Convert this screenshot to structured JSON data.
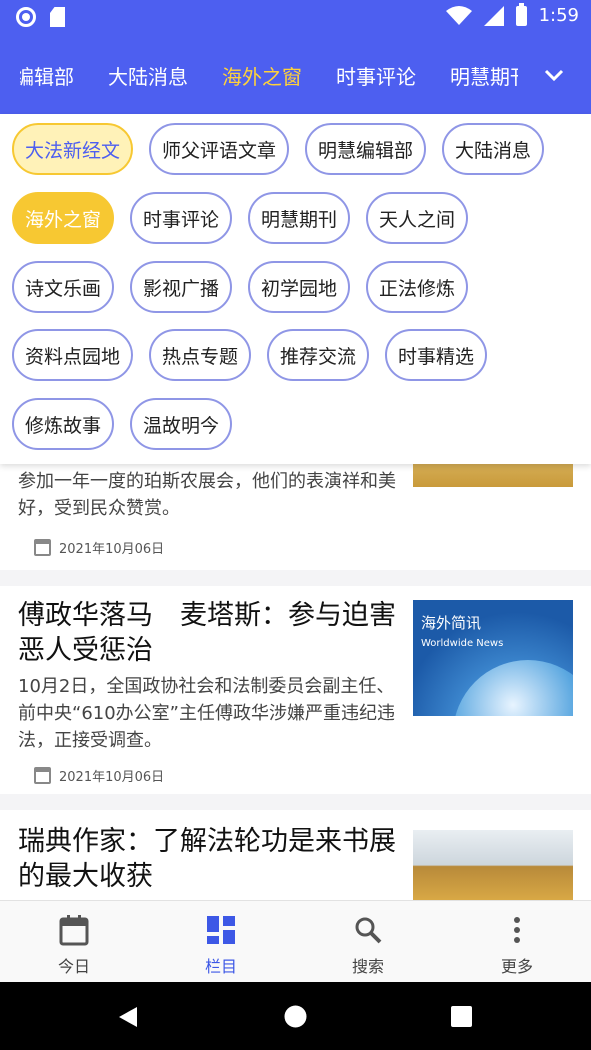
{
  "status_bar": {
    "time": "1:59"
  },
  "top_tabs": [
    {
      "label": "编辑部",
      "active": false
    },
    {
      "label": "大陆消息",
      "active": false
    },
    {
      "label": "海外之窗",
      "active": true
    },
    {
      "label": "时事评论",
      "active": false
    },
    {
      "label": "明慧期刊",
      "active": false
    }
  ],
  "categories": [
    [
      "大法新经文",
      "师父评语文章",
      "明慧编辑部",
      "大陆消息"
    ],
    [
      "海外之窗",
      "时事评论",
      "明慧期刊",
      "天人之间"
    ],
    [
      "诗文乐画",
      "影视广播",
      "初学园地",
      "正法修炼"
    ],
    [
      "资料点园地",
      "热点专题",
      "推荐交流",
      "时事精选"
    ],
    [
      "修炼故事",
      "温故明今"
    ]
  ],
  "articles": [
    {
      "summary": "参加一年一度的珀斯农展会，他们的表演祥和美好，受到民众赞赏。",
      "date": "2021年10月06日"
    },
    {
      "title": "傅政华落马　麦塔斯：参与迫害　恶人受惩治",
      "summary": "10月2日，全国政协社会和法制委员会副主任、前中央“610办公室”主任傅政华涉嫌严重违纪违法，正接受调查。",
      "date": "2021年10月06日",
      "thumb_title": "海外简讯",
      "thumb_sub": "Worldwide News"
    },
    {
      "title": "瑞典作家：了解法轮功是来书展的最大收获"
    }
  ],
  "bottom_nav": [
    {
      "label": "今日"
    },
    {
      "label": "栏目"
    },
    {
      "label": "搜索"
    },
    {
      "label": "更多"
    }
  ],
  "colors": {
    "primary": "#4d5ff0",
    "accent": "#f7c832"
  }
}
